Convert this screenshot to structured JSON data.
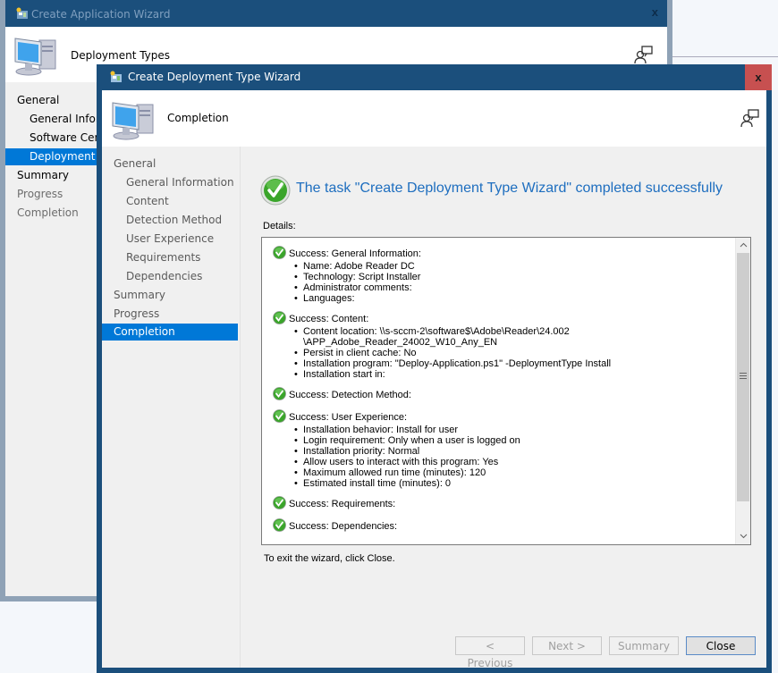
{
  "background_window": {
    "title": "Create Application Wizard",
    "close_label": "x",
    "header_title": "Deployment Types",
    "nav": [
      {
        "label": "General",
        "level": 0,
        "state": "normal"
      },
      {
        "label": "General Inform",
        "level": 1,
        "state": "normal"
      },
      {
        "label": "Software Cente",
        "level": 1,
        "state": "normal"
      },
      {
        "label": "Deployment Ty",
        "level": 1,
        "state": "selected"
      },
      {
        "label": "Summary",
        "level": 0,
        "state": "normal"
      },
      {
        "label": "Progress",
        "level": 0,
        "state": "muted"
      },
      {
        "label": "Completion",
        "level": 0,
        "state": "muted"
      }
    ]
  },
  "wizard": {
    "title": "Create Deployment Type Wizard",
    "close_label": "x",
    "header_title": "Completion",
    "nav": [
      {
        "label": "General",
        "level": 0
      },
      {
        "label": "General Information",
        "level": 1
      },
      {
        "label": "Content",
        "level": 1
      },
      {
        "label": "Detection Method",
        "level": 1
      },
      {
        "label": "User Experience",
        "level": 1
      },
      {
        "label": "Requirements",
        "level": 1
      },
      {
        "label": "Dependencies",
        "level": 1
      },
      {
        "label": "Summary",
        "level": 0
      },
      {
        "label": "Progress",
        "level": 0
      },
      {
        "label": "Completion",
        "level": 0,
        "selected": true
      }
    ],
    "success_message": "The task \"Create Deployment Type Wizard\" completed successfully",
    "details_label": "Details:",
    "details": [
      {
        "heading": "Success: General Information:",
        "items": [
          "Name: Adobe Reader DC",
          "Technology: Script Installer",
          "Administrator comments:",
          "Languages:"
        ]
      },
      {
        "heading": "Success: Content:",
        "items": [
          "Content location: \\\\s-sccm-2\\software$\\Adobe\\Reader\\24.002 \\APP_Adobe_Reader_24002_W10_Any_EN",
          "Persist in client cache: No",
          "Installation program: \"Deploy-Application.ps1\" -DeploymentType Install",
          "Installation start in:"
        ]
      },
      {
        "heading": "Success: Detection Method:",
        "items": []
      },
      {
        "heading": "Success: User Experience:",
        "items": [
          "Installation behavior: Install for user",
          "Login requirement: Only when a user is logged on",
          "Installation priority: Normal",
          "Allow users to interact with this program: Yes",
          "Maximum allowed run time (minutes): 120",
          "Estimated install time (minutes): 0"
        ]
      },
      {
        "heading": "Success: Requirements:",
        "items": []
      },
      {
        "heading": "Success: Dependencies:",
        "items": []
      }
    ],
    "scroll": {
      "up_glyph": "^",
      "down_glyph": "v",
      "visible_fraction": 0.82,
      "position_fraction": 0.0
    },
    "exit_hint": "To exit the wizard, click Close.",
    "buttons": {
      "previous": "< Previous",
      "next": "Next >",
      "summary": "Summary",
      "close": "Close"
    }
  },
  "colors": {
    "titlebar": "#1b4f7c",
    "selection": "#0078d7",
    "close_button": "#c75050",
    "success_text": "#1e6ebf",
    "success_green": "#3aa52a"
  }
}
